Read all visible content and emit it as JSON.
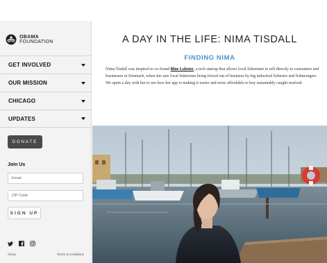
{
  "logo": {
    "line1": "OBAMA",
    "line2": "FOUNDATION"
  },
  "nav": {
    "items": [
      {
        "label": "GET INVOLVED"
      },
      {
        "label": "OUR MISSION"
      },
      {
        "label": "CHICAGO"
      },
      {
        "label": "UPDATES"
      }
    ]
  },
  "donate_label": "DONATE",
  "join": {
    "heading": "Join Us",
    "email_placeholder": "Email",
    "zip_placeholder": "ZIP Code",
    "signup_label": "SIGN UP"
  },
  "social": {
    "icons": [
      "twitter-icon",
      "facebook-icon",
      "instagram-icon"
    ]
  },
  "footer": {
    "about": "About",
    "terms": "Terms & Conditions"
  },
  "article": {
    "title": "A DAY IN THE LIFE: NIMA TISDALL",
    "subtitle": "FINDING NIMA",
    "body_before": "Nima Tisdall was inspired to co-found ",
    "link": "Blue Lobster",
    "body_after": ", a tech startup that allows local fishermen to sell directly to consumers and businesses in Denmark, when she saw local fishermen being forced out of business by big industrial fisheries and fishmongers. We spent a day with her to see how her app is making it easier and more affordable to buy sustainably caught seafood."
  },
  "colors": {
    "accent": "#4a90c9",
    "donate_bg": "#4a4a4a",
    "sidebar_bg": "#f3f3f3"
  }
}
